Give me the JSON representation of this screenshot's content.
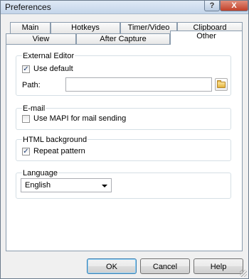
{
  "window": {
    "title": "Preferences",
    "help_label": "?",
    "close_label": "X"
  },
  "tabs_row1": [
    {
      "label": "Main"
    },
    {
      "label": "Hotkeys"
    },
    {
      "label": "Timer/Video"
    },
    {
      "label": "Clipboard"
    }
  ],
  "tabs_row2": [
    {
      "label": "View"
    },
    {
      "label": "After Capture"
    },
    {
      "label": "Other",
      "active": true
    }
  ],
  "external_editor": {
    "group_label": "External Editor",
    "use_default_label": "Use default",
    "use_default_checked": true,
    "path_label": "Path:",
    "path_value": ""
  },
  "email": {
    "group_label": "E-mail",
    "mapi_label": "Use MAPI for mail sending",
    "mapi_checked": false
  },
  "html_background": {
    "group_label": "HTML background",
    "repeat_label": "Repeat  pattern",
    "repeat_checked": true
  },
  "language": {
    "group_label": "Language",
    "selected": "English"
  },
  "buttons": {
    "ok": "OK",
    "cancel": "Cancel",
    "help": "Help"
  },
  "check_mark": "✓"
}
